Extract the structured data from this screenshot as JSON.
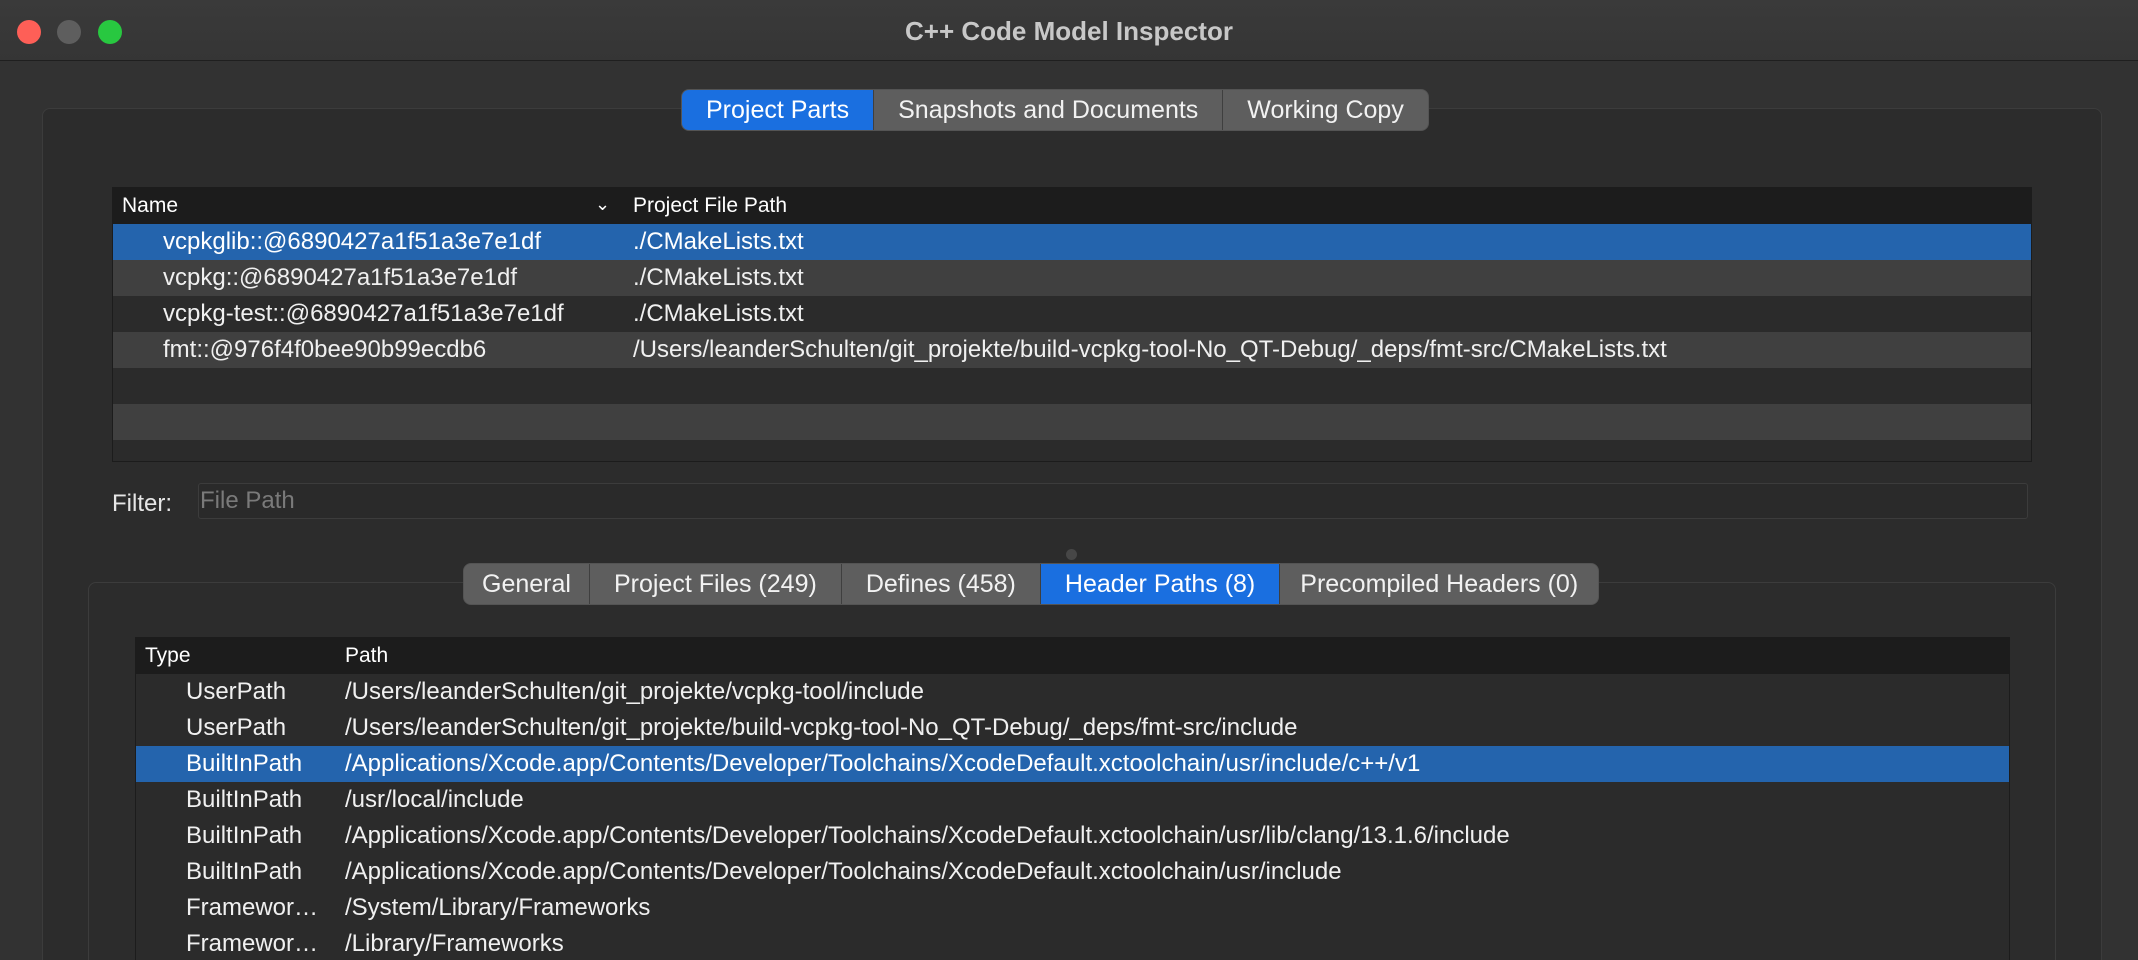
{
  "window": {
    "title": "C++ Code Model Inspector"
  },
  "main_tabs": [
    {
      "label": "Project Parts",
      "active": true
    },
    {
      "label": "Snapshots and Documents",
      "active": false
    },
    {
      "label": "Working Copy",
      "active": false
    }
  ],
  "parts_table": {
    "headers": {
      "name": "Name",
      "path": "Project File Path"
    },
    "rows": [
      {
        "name": "vcpkglib::@6890427a1f51a3e7e1df",
        "path": "./CMakeLists.txt"
      },
      {
        "name": "vcpkg::@6890427a1f51a3e7e1df",
        "path": "./CMakeLists.txt"
      },
      {
        "name": "vcpkg-test::@6890427a1f51a3e7e1df",
        "path": "./CMakeLists.txt"
      },
      {
        "name": "fmt::@976f4f0bee90b99ecdb6",
        "path": "/Users/leanderSchulten/git_projekte/build-vcpkg-tool-No_QT-Debug/_deps/fmt-src/CMakeLists.txt"
      }
    ]
  },
  "filter": {
    "label": "Filter:",
    "placeholder": "File Path",
    "value": ""
  },
  "detail_tabs": [
    {
      "label": "General",
      "active": false
    },
    {
      "label": "Project Files (249)",
      "active": false
    },
    {
      "label": "Defines (458)",
      "active": false
    },
    {
      "label": "Header Paths (8)",
      "active": true
    },
    {
      "label": "Precompiled Headers (0)",
      "active": false
    }
  ],
  "header_paths_table": {
    "headers": {
      "type": "Type",
      "path": "Path"
    },
    "rows": [
      {
        "type": "UserPath",
        "path": "/Users/leanderSchulten/git_projekte/vcpkg-tool/include"
      },
      {
        "type": "UserPath",
        "path": "/Users/leanderSchulten/git_projekte/build-vcpkg-tool-No_QT-Debug/_deps/fmt-src/include"
      },
      {
        "type": "BuiltInPath",
        "path": "/Applications/Xcode.app/Contents/Developer/Toolchains/XcodeDefault.xctoolchain/usr/include/c++/v1"
      },
      {
        "type": "BuiltInPath",
        "path": "/usr/local/include"
      },
      {
        "type": "BuiltInPath",
        "path": "/Applications/Xcode.app/Contents/Developer/Toolchains/XcodeDefault.xctoolchain/usr/lib/clang/13.1.6/include"
      },
      {
        "type": "BuiltInPath",
        "path": "/Applications/Xcode.app/Contents/Developer/Toolchains/XcodeDefault.xctoolchain/usr/include"
      },
      {
        "type": "Framewor…",
        "path": "/System/Library/Frameworks"
      },
      {
        "type": "Framewor…",
        "path": "/Library/Frameworks"
      }
    ]
  }
}
